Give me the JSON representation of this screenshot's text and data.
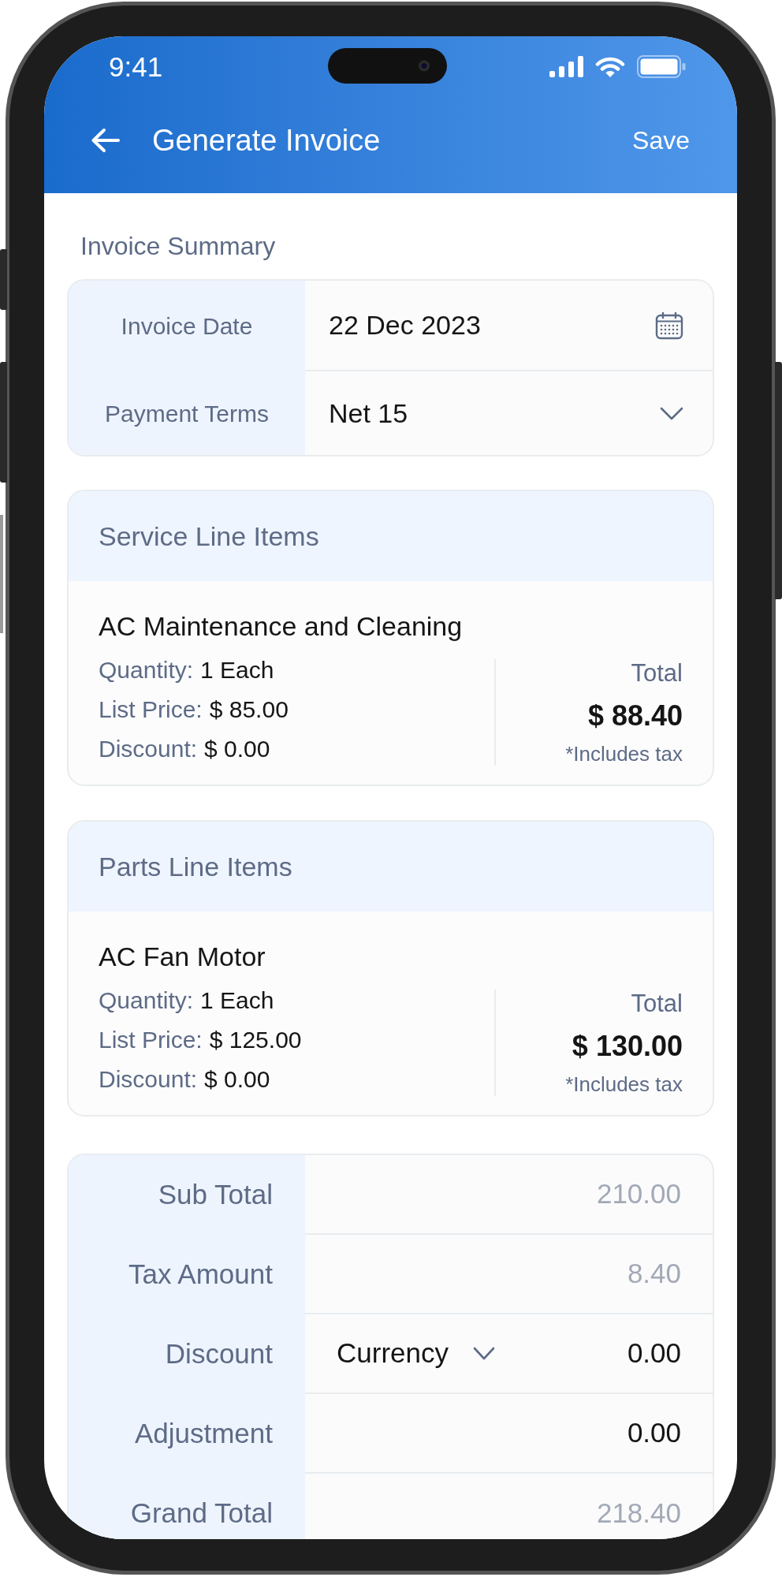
{
  "status_bar": {
    "time": "9:41"
  },
  "header": {
    "title": "Generate Invoice",
    "action": "Save"
  },
  "invoice_summary": {
    "title": "Invoice Summary",
    "fields": [
      {
        "label": "Invoice Date",
        "value": "22 Dec 2023",
        "kind": "date"
      },
      {
        "label": "Payment Terms",
        "value": "Net 15",
        "kind": "select"
      }
    ]
  },
  "line_item_sections": [
    {
      "title": "Service Line Items",
      "items": [
        {
          "name": "AC Maintenance and Cleaning",
          "details": [
            {
              "label": "Quantity:",
              "value": "1 Each"
            },
            {
              "label": "List Price:",
              "value": "$ 85.00"
            },
            {
              "label": "Discount:",
              "value": "$ 0.00"
            }
          ],
          "total_label": "Total",
          "total": "$ 88.40",
          "note": "*Includes tax"
        }
      ]
    },
    {
      "title": "Parts Line Items",
      "items": [
        {
          "name": "AC Fan Motor",
          "details": [
            {
              "label": "Quantity:",
              "value": "1 Each"
            },
            {
              "label": "List Price:",
              "value": "$ 125.00"
            },
            {
              "label": "Discount:",
              "value": "$ 0.00"
            }
          ],
          "total_label": "Total",
          "total": "$ 130.00",
          "note": "*Includes tax"
        }
      ]
    }
  ],
  "totals": [
    {
      "label": "Sub Total",
      "value": "210.00",
      "kind": "readonly"
    },
    {
      "label": "Tax Amount",
      "value": "8.40",
      "kind": "readonly"
    },
    {
      "label": "Discount",
      "unit": "Currency",
      "value": "0.00",
      "kind": "discount"
    },
    {
      "label": "Adjustment",
      "value": "0.00",
      "kind": "input"
    },
    {
      "label": "Grand Total",
      "value": "218.40",
      "kind": "readonly"
    }
  ]
}
